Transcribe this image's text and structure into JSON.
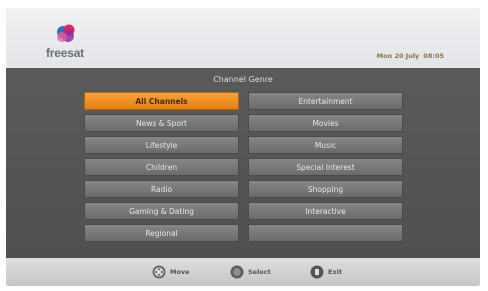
{
  "header": {
    "logo_text": "freesat",
    "date": "Mon 20 July",
    "time": "08:05"
  },
  "menu": {
    "title": "Channel Genre",
    "left_column": [
      "All Channels",
      "News & Sport",
      "Lifestyle",
      "Children",
      "Radio",
      "Gaming & Dating",
      "Regional"
    ],
    "right_column": [
      "Entertainment",
      "Movies",
      "Music",
      "Special Interest",
      "Shopping",
      "Interactive",
      ""
    ],
    "selected": "All Channels"
  },
  "footer": {
    "hints": [
      {
        "label": "Move",
        "icon": "navigation-pad-icon"
      },
      {
        "label": "Select",
        "icon": "ok-button-icon"
      },
      {
        "label": "Exit",
        "icon": "exit-button-icon"
      }
    ]
  },
  "colors": {
    "accent": "#f39425",
    "button": "#7a7a7a",
    "background": "#5a5a5a",
    "footer": "#d2d2d2"
  }
}
